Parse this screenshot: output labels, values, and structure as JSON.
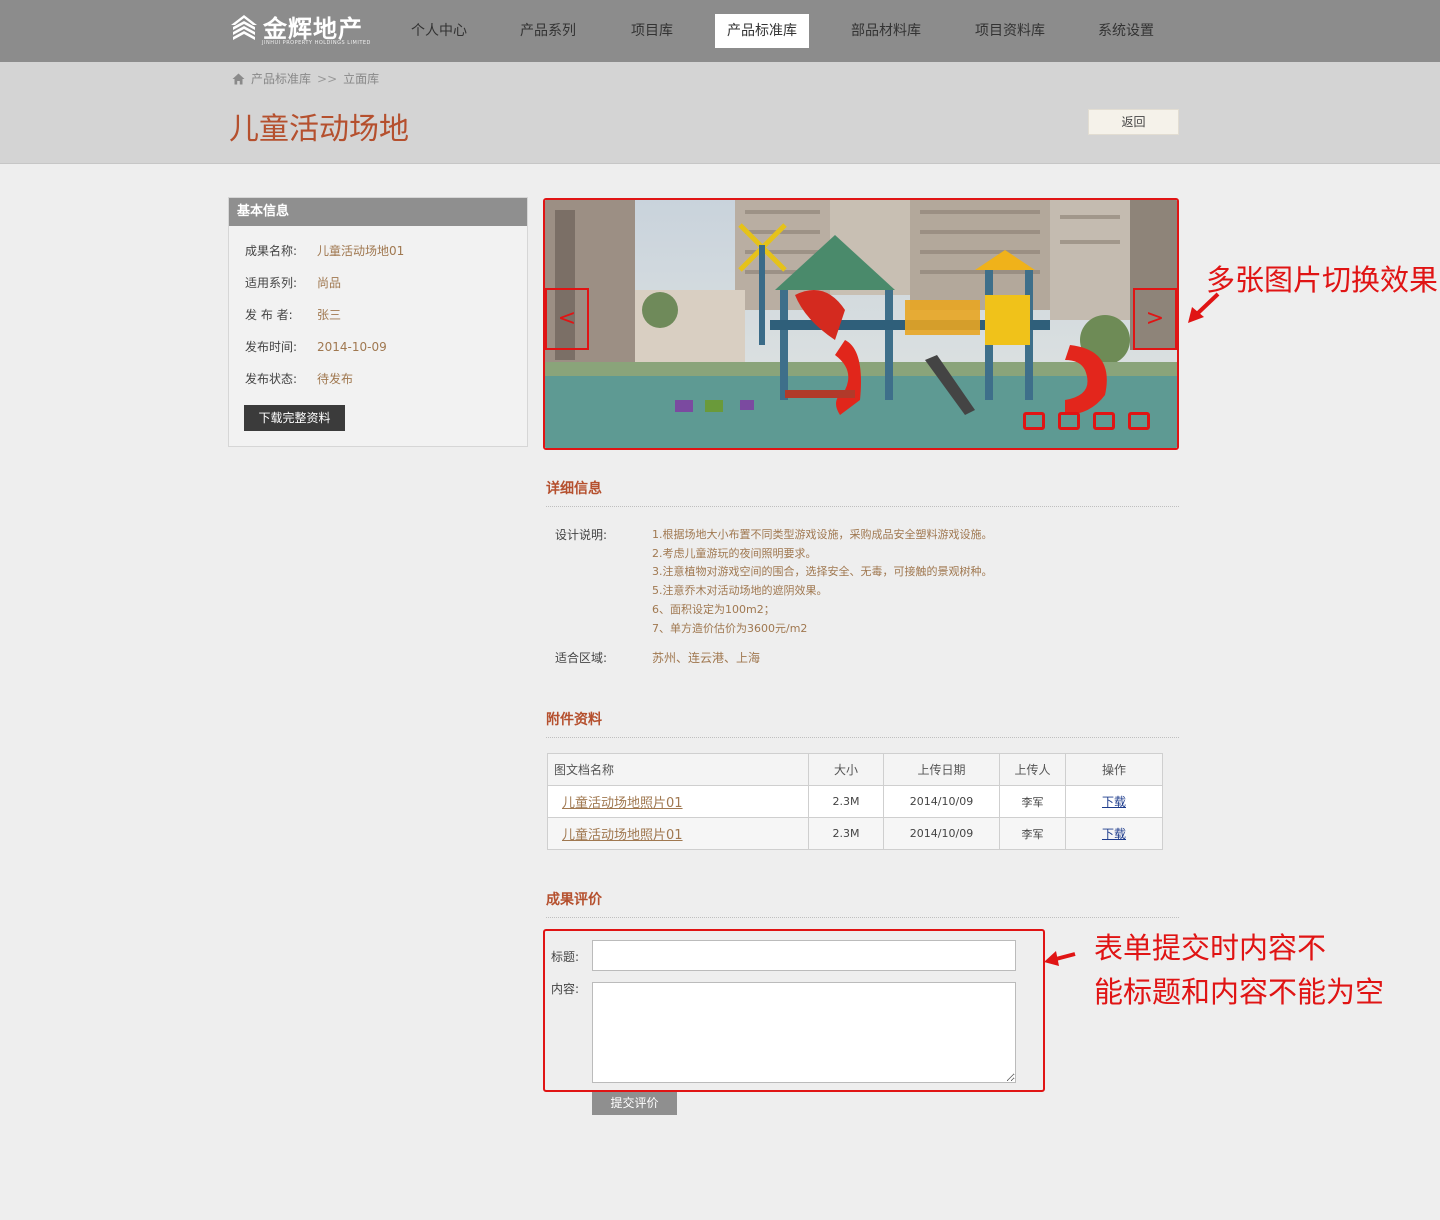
{
  "brand": {
    "name": "金辉地产",
    "sub": "JINHUI PROPERTY HOLDINGS LIMITED"
  },
  "nav": [
    {
      "label": "个人中心"
    },
    {
      "label": "产品系列"
    },
    {
      "label": "项目库"
    },
    {
      "label": "产品标准库",
      "active": true
    },
    {
      "label": "部品材料库"
    },
    {
      "label": "项目资料库"
    },
    {
      "label": "系统设置"
    }
  ],
  "breadcrumb": {
    "root": "产品标准库",
    "sep": ">>",
    "current": "立面库"
  },
  "page": {
    "title": "儿童活动场地",
    "back_label": "返回"
  },
  "basic_info": {
    "title": "基本信息",
    "rows": [
      {
        "k": "成果名称:",
        "v": "儿童活动场地01"
      },
      {
        "k": "适用系列:",
        "v": "尚品"
      },
      {
        "k": "发 布 者:",
        "v": "张三"
      },
      {
        "k": "发布时间:",
        "v": "2014-10-09"
      },
      {
        "k": "发布状态:",
        "v": "待发布"
      }
    ],
    "download_label": "下载完整资料"
  },
  "slider": {
    "prev": "<",
    "next": ">",
    "dot_count": 4
  },
  "detail": {
    "title": "详细信息",
    "design_label": "设计说明:",
    "design_lines": [
      "1.根据场地大小布置不同类型游戏设施，采购成品安全塑料游戏设施。",
      "2.考虑儿童游玩的夜间照明要求。",
      "3.注意植物对游戏空间的围合，选择安全、无毒，可接触的景观树种。",
      "5.注意乔木对活动场地的遮阴效果。",
      "6、面积设定为100m2；",
      "7、单方造价估价为3600元/m2"
    ],
    "region_label": "适合区域:",
    "region_value": "苏州、连云港、上海"
  },
  "attachments": {
    "title": "附件资料",
    "headers": [
      "图文档名称",
      "大小",
      "上传日期",
      "上传人",
      "操作"
    ],
    "rows": [
      {
        "name": "儿童活动场地照片01",
        "size": "2.3M",
        "date": "2014/10/09",
        "uploader": "李军",
        "op": "下载"
      },
      {
        "name": "儿童活动场地照片01",
        "size": "2.3M",
        "date": "2014/10/09",
        "uploader": "李军",
        "op": "下载"
      }
    ]
  },
  "review": {
    "title": "成果评价",
    "title_label": "标题:",
    "content_label": "内容:",
    "submit_label": "提交评价"
  },
  "annotations": {
    "slider_note": "多张图片切换效果",
    "form_note_line1": "表单提交时内容不",
    "form_note_line2": "能标题和内容不能为空"
  },
  "colors": {
    "accent": "#b5502e",
    "annotation": "#e01414",
    "nav_bg": "#8c8c8c",
    "value_text": "#a07850"
  }
}
